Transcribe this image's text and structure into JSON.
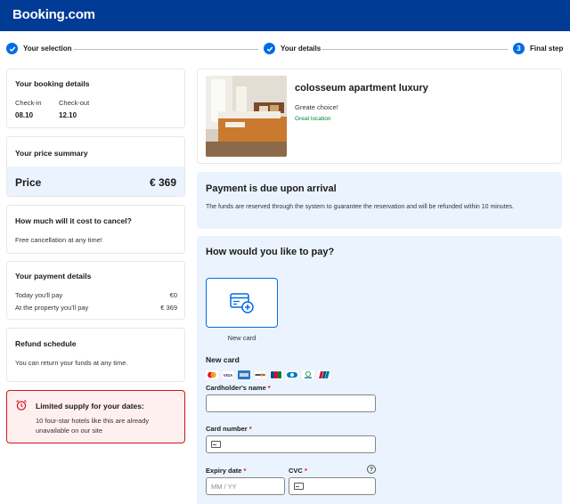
{
  "header": {
    "brand": "Booking.com",
    "brand_color": "#003b95"
  },
  "steps": [
    {
      "label": "Your selection",
      "state": "done"
    },
    {
      "label": "Your details",
      "state": "done"
    },
    {
      "number": "3",
      "label": "Final step",
      "state": "current"
    }
  ],
  "booking_details": {
    "title": "Your booking details",
    "checkin_label": "Check-in",
    "checkin_value": "08.10",
    "checkout_label": "Check-out",
    "checkout_value": "12.10"
  },
  "price_summary": {
    "title": "Your price summary",
    "price_label": "Price",
    "price_value": "€ 369"
  },
  "cancel": {
    "title": "How much will it cost to cancel?",
    "text": "Free cancellation at any time!"
  },
  "payment_details": {
    "title": "Your payment details",
    "rows": [
      {
        "label": "Today you'll pay",
        "value": "€0"
      },
      {
        "label": "At the property you'll pay",
        "value": "€ 369"
      }
    ]
  },
  "refund": {
    "title": "Refund schedule",
    "text": "You can return your funds at any time."
  },
  "limited": {
    "title": "Limited supply for your dates:",
    "text": "10 four-star hotels like this are already unavailable on our site"
  },
  "property": {
    "name": "colosseum apartment luxury",
    "subtitle": "Greate choice!",
    "location": "Great location"
  },
  "due": {
    "title": "Payment is due upon arrival",
    "text": "The funds are reserved through the system to guarantee the reservation and will be refunded within 10 minutes."
  },
  "pay": {
    "title": "How would you like to pay?",
    "tile_caption": "New card",
    "new_card_heading": "New card",
    "card_logos": [
      "mastercard",
      "visa",
      "amex",
      "discover",
      "jcb",
      "diners",
      "maestro",
      "unionpay"
    ],
    "cardholder_label": "Cardholder's name",
    "card_number_label": "Card number",
    "expiry_label": "Expiry date",
    "expiry_placeholder": "MM / YY",
    "cvc_label": "CVC",
    "required_mark": "*",
    "help_glyph": "?"
  }
}
